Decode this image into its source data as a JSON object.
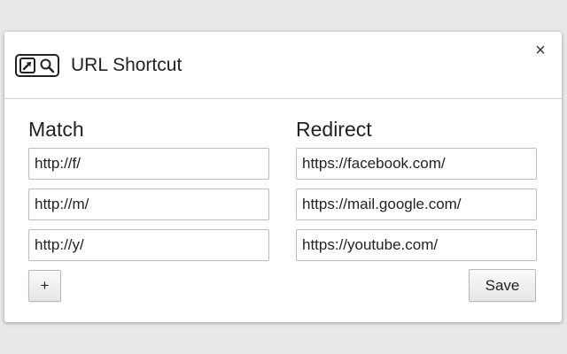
{
  "dialog": {
    "title": "URL Shortcut",
    "close_label": "×",
    "logo_icons": [
      "external-link-icon",
      "search-icon"
    ]
  },
  "columns": {
    "match_heading": "Match",
    "redirect_heading": "Redirect"
  },
  "rules": [
    {
      "match": "http://f/",
      "redirect": "https://facebook.com/"
    },
    {
      "match": "http://m/",
      "redirect": "https://mail.google.com/"
    },
    {
      "match": "http://y/",
      "redirect": "https://youtube.com/"
    }
  ],
  "buttons": {
    "add_label": "+",
    "save_label": "Save"
  }
}
